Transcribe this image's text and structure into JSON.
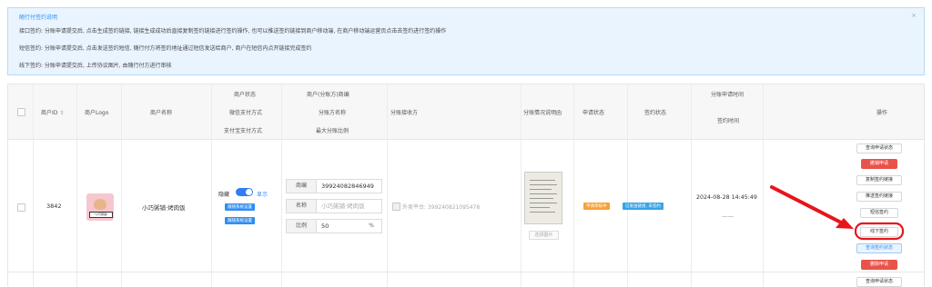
{
  "notice": {
    "title": "随行付签约说明",
    "close": "×",
    "lines": [
      "接口签约: 分账申请提交后, 点击生成签约链接, 链接生成成功后直接复制签约链接进行签约操作, 也可以推送签约链接到商户移动端, 在商户移动端运营页点击去签约进行签约操作",
      "短信签约: 分账申请提交后, 点击发送签约短信, 随行付方将签约地址通过短信发送给商户, 商户在短信内点开链接完成签约",
      "线下签约: 分账申请提交后, 上传协议图片, 由随行付方进行审核"
    ]
  },
  "headers": {
    "merchant_id": "商户ID",
    "sort_icon": "⇕",
    "logo": "商户Logo",
    "name": "商户名称",
    "status_1": "商户状态",
    "status_2": "微信支付方式",
    "status_3": "支付宝支付方式",
    "payee_1": "商户(分账方)商编",
    "payee_2": "分账方名称",
    "payee_3": "最大分账比例",
    "receiver": "分账接收方",
    "desc_image": "分账情况说明函",
    "apply_status": "申请状态",
    "sign_status": "签约状态",
    "time_1": "分账申请时间",
    "time_2": "签约时间",
    "actions": "操作"
  },
  "row": {
    "merchant_id": "3842",
    "name": "小巧粥铺·烤肉饭",
    "logo_text": "*小巧粥铺*",
    "hidden_label": "隐藏",
    "show_label": "显示",
    "wx_tag": "跟随系统设置",
    "ali_tag": "跟随系统设置",
    "field_code_label": "商编",
    "field_code_value": "39924082846949",
    "field_name_label": "名称",
    "field_name_value": "小巧粥铺·烤肉饭",
    "field_ratio_label": "比例",
    "field_ratio_value": "50",
    "field_ratio_unit": "%",
    "receiver_text": "外卖平台: 399240821095478",
    "upload_label": "选择图片",
    "apply_status": "申请审核中",
    "sign_status": "已发送链接, 未签约",
    "apply_time": "2024-08-28 14:45:49",
    "sign_time": "——"
  },
  "actions": [
    "查询申请状态",
    "撤销申请",
    "复制签约链接",
    "推送签约链接",
    "短信签约",
    "线下签约",
    "查询签约状态",
    "删除申请"
  ],
  "next_row_action": "查询申请状态",
  "colors": {
    "accent_blue": "#2f8ef3",
    "danger_red": "#e9534a",
    "warning_orange": "#f6a23a",
    "annotation_red": "#e8141c"
  }
}
